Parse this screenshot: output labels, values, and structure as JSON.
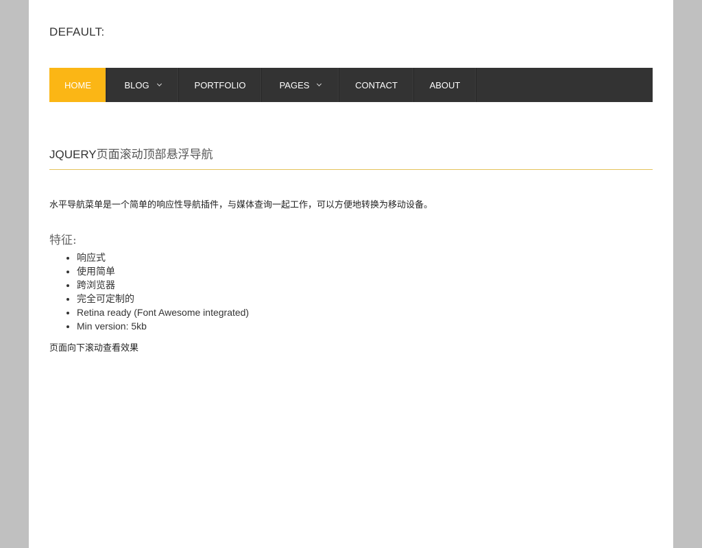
{
  "site": {
    "title": "DEFAULT:"
  },
  "nav": {
    "items": [
      {
        "label": "HOME",
        "active": true,
        "has_dropdown": false
      },
      {
        "label": "BLOG",
        "active": false,
        "has_dropdown": true
      },
      {
        "label": "PORTFOLIO",
        "active": false,
        "has_dropdown": false
      },
      {
        "label": "PAGES",
        "active": false,
        "has_dropdown": true
      },
      {
        "label": "CONTACT",
        "active": false,
        "has_dropdown": false
      },
      {
        "label": "ABOUT",
        "active": false,
        "has_dropdown": false
      }
    ],
    "dropdown_icon": "chevron-down-icon"
  },
  "article": {
    "heading_latin": "JQUERY",
    "heading_cn": "页面滚动顶部悬浮导航",
    "intro": "水平导航菜单是一个简单的响应性导航插件，与媒体查询一起工作，可以方便地转换为移动设备。",
    "features_title": "特征:",
    "features": [
      "响应式",
      "使用简单",
      "跨浏览器",
      "完全可定制的",
      "Retina ready (Font Awesome integrated)",
      "Min version: 5kb"
    ],
    "scroll_note": "页面向下滚动查看效果"
  },
  "colors": {
    "accent": "#fbb615",
    "nav_bg": "#333333",
    "heading_rule": "#e5c35a",
    "page_bg": "#c0c0c0"
  }
}
